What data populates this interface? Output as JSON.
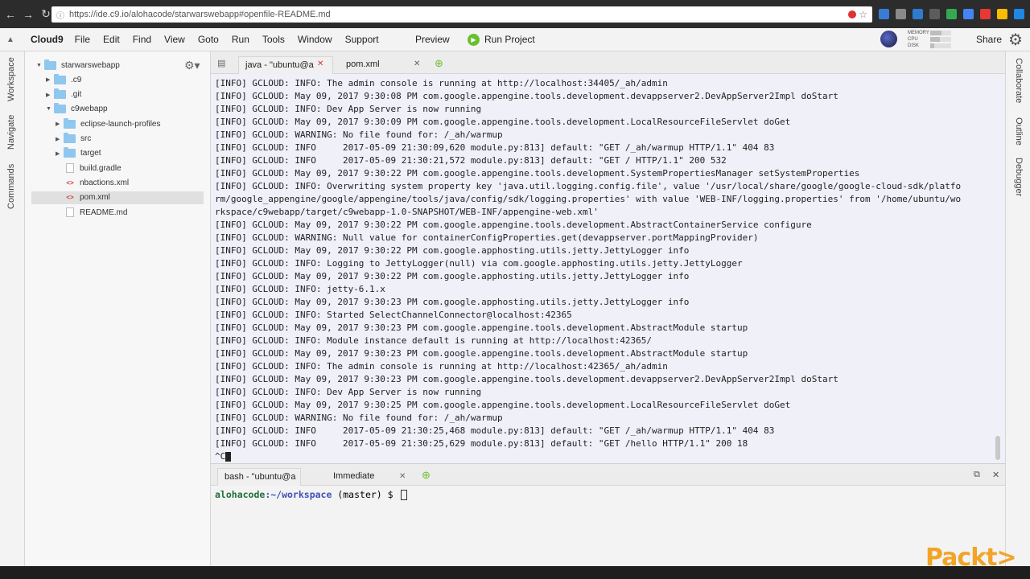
{
  "browser": {
    "url": "https://ide.c9.io/alohacode/starwarswebapp#openfile-README.md",
    "extensions": [
      "#3a7bd5",
      "#8a8a8a",
      "#2e7bcf",
      "#5c5c5c",
      "#34a853",
      "#4285f4",
      "#e53935",
      "#fbbc04",
      "#1e88e5",
      "#8c8c8c"
    ]
  },
  "menubar": {
    "brand": "Cloud9",
    "items": [
      "File",
      "Edit",
      "Find",
      "View",
      "Goto",
      "Run",
      "Tools",
      "Window",
      "Support"
    ],
    "preview": "Preview",
    "run_project": "Run Project",
    "stats": [
      {
        "label": "MEMORY",
        "level": 0.55
      },
      {
        "label": "CPU",
        "level": 0.45
      },
      {
        "label": "DISK",
        "level": 0.2
      }
    ],
    "share": "Share"
  },
  "left_tabs": [
    "Workspace",
    "Navigate",
    "Commands"
  ],
  "right_tabs": [
    "Collaborate",
    "Outline",
    "Debugger"
  ],
  "tree": {
    "items": [
      {
        "name": "starwarswebapp",
        "type": "folder",
        "depth": 0,
        "expanded": true
      },
      {
        "name": ".c9",
        "type": "folder",
        "depth": 1,
        "expanded": false
      },
      {
        "name": ".git",
        "type": "folder",
        "depth": 1,
        "expanded": false
      },
      {
        "name": "c9webapp",
        "type": "folder",
        "depth": 1,
        "expanded": true
      },
      {
        "name": "eclipse-launch-profiles",
        "type": "folder",
        "depth": 2,
        "expanded": false
      },
      {
        "name": "src",
        "type": "folder",
        "depth": 2,
        "expanded": false
      },
      {
        "name": "target",
        "type": "folder",
        "depth": 2,
        "expanded": false
      },
      {
        "name": "build.gradle",
        "type": "file",
        "depth": 2
      },
      {
        "name": "nbactions.xml",
        "type": "xml",
        "depth": 2
      },
      {
        "name": "pom.xml",
        "type": "xml",
        "depth": 2,
        "selected": true
      },
      {
        "name": "README.md",
        "type": "file",
        "depth": 2
      }
    ]
  },
  "editor_tabs": [
    {
      "label": "java - \"ubuntu@a",
      "active": true
    },
    {
      "label": "pom.xml",
      "active": false
    }
  ],
  "console": {
    "lines": [
      "[INFO] GCLOUD: INFO: The admin console is running at http://localhost:34405/_ah/admin",
      "[INFO] GCLOUD: May 09, 2017 9:30:08 PM com.google.appengine.tools.development.devappserver2.DevAppServer2Impl doStart",
      "[INFO] GCLOUD: INFO: Dev App Server is now running",
      "[INFO] GCLOUD: May 09, 2017 9:30:09 PM com.google.appengine.tools.development.LocalResourceFileServlet doGet",
      "[INFO] GCLOUD: WARNING: No file found for: /_ah/warmup",
      "[INFO] GCLOUD: INFO     2017-05-09 21:30:09,620 module.py:813] default: \"GET /_ah/warmup HTTP/1.1\" 404 83",
      "[INFO] GCLOUD: INFO     2017-05-09 21:30:21,572 module.py:813] default: \"GET / HTTP/1.1\" 200 532",
      "[INFO] GCLOUD: May 09, 2017 9:30:22 PM com.google.appengine.tools.development.SystemPropertiesManager setSystemProperties",
      "[INFO] GCLOUD: INFO: Overwriting system property key 'java.util.logging.config.file', value '/usr/local/share/google/google-cloud-sdk/platfo",
      "rm/google_appengine/google/appengine/tools/java/config/sdk/logging.properties' with value 'WEB-INF/logging.properties' from '/home/ubuntu/wo",
      "rkspace/c9webapp/target/c9webapp-1.0-SNAPSHOT/WEB-INF/appengine-web.xml'",
      "[INFO] GCLOUD: May 09, 2017 9:30:22 PM com.google.appengine.tools.development.AbstractContainerService configure",
      "[INFO] GCLOUD: WARNING: Null value for containerConfigProperties.get(devappserver.portMappingProvider)",
      "[INFO] GCLOUD: May 09, 2017 9:30:22 PM com.google.apphosting.utils.jetty.JettyLogger info",
      "[INFO] GCLOUD: INFO: Logging to JettyLogger(null) via com.google.apphosting.utils.jetty.JettyLogger",
      "[INFO] GCLOUD: May 09, 2017 9:30:22 PM com.google.apphosting.utils.jetty.JettyLogger info",
      "[INFO] GCLOUD: INFO: jetty-6.1.x",
      "[INFO] GCLOUD: May 09, 2017 9:30:23 PM com.google.apphosting.utils.jetty.JettyLogger info",
      "[INFO] GCLOUD: INFO: Started SelectChannelConnector@localhost:42365",
      "[INFO] GCLOUD: May 09, 2017 9:30:23 PM com.google.appengine.tools.development.AbstractModule startup",
      "[INFO] GCLOUD: INFO: Module instance default is running at http://localhost:42365/",
      "[INFO] GCLOUD: May 09, 2017 9:30:23 PM com.google.appengine.tools.development.AbstractModule startup",
      "[INFO] GCLOUD: INFO: The admin console is running at http://localhost:42365/_ah/admin",
      "[INFO] GCLOUD: May 09, 2017 9:30:23 PM com.google.appengine.tools.development.devappserver2.DevAppServer2Impl doStart",
      "[INFO] GCLOUD: INFO: Dev App Server is now running",
      "[INFO] GCLOUD: May 09, 2017 9:30:25 PM com.google.appengine.tools.development.LocalResourceFileServlet doGet",
      "[INFO] GCLOUD: WARNING: No file found for: /_ah/warmup",
      "[INFO] GCLOUD: INFO     2017-05-09 21:30:25,468 module.py:813] default: \"GET /_ah/warmup HTTP/1.1\" 404 83",
      "[INFO] GCLOUD: INFO     2017-05-09 21:30:25,629 module.py:813] default: \"GET /hello HTTP/1.1\" 200 18"
    ],
    "last_line": "^C"
  },
  "lower_tabs": [
    {
      "label": "bash - \"ubuntu@a",
      "active": true
    },
    {
      "label": "Immediate",
      "active": false
    }
  ],
  "terminal": {
    "user": "alohacode",
    "path": ":~/workspace",
    "branch": " (master) $ "
  },
  "watermark": "Packt>"
}
